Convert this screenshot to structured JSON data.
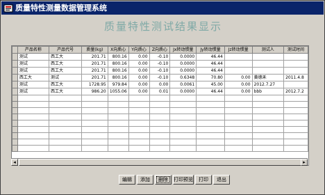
{
  "window": {
    "title": "质量特性测量数据管理系统"
  },
  "heading": "质量特性测试结果显示",
  "grid": {
    "columns": [
      "",
      "产品名称",
      "产品代号",
      "质量(kg)",
      "X向质心",
      "Y向质心",
      "Z向质心",
      "Jx转动惯量",
      "Jy转动惯量",
      "Jz转动惯量",
      "测试人",
      "测试时间"
    ],
    "rows": [
      [
        "",
        "测试",
        "西工大",
        "201.71",
        "800.16",
        "0.00",
        "-0.10",
        "0.0000",
        "46.44",
        "",
        "",
        ""
      ],
      [
        "",
        "测试",
        "西工大",
        "201.71",
        "800.16",
        "0.00",
        "-0.10",
        "0.0000",
        "46.44",
        "",
        "",
        ""
      ],
      [
        "",
        "测试",
        "西工大",
        "201.71",
        "800.16",
        "0.00",
        "-0.10",
        "0.0000",
        "46.44",
        "",
        "",
        ""
      ],
      [
        "",
        "西工大",
        "测试",
        "201.71",
        "800.16",
        "0.00",
        "-0.10",
        "0.6348",
        "70.80",
        "0.00",
        "黄德禾",
        "2011.4.8"
      ],
      [
        "",
        "测试",
        "西工大",
        "1728.95",
        "979.84",
        "0.00",
        "0.00",
        "0.0061",
        "45.00",
        "0.00",
        "2012.7.27",
        ""
      ],
      [
        "",
        "测试",
        "西工大",
        "986.20",
        "1055.06",
        "0.00",
        "0.01",
        "0.0000",
        "46.44",
        "0.00",
        "bbb",
        "2012.7.2"
      ]
    ],
    "empty_rows": 9
  },
  "buttons": {
    "edit": "编辑",
    "add": "添加",
    "delete": "删除",
    "print_preview": "打印预览",
    "print": "打印",
    "exit": "退出"
  },
  "colors": {
    "titlebar": "#0a246a",
    "window_face": "#d4d0c8",
    "heading": "#7fa9a6"
  }
}
